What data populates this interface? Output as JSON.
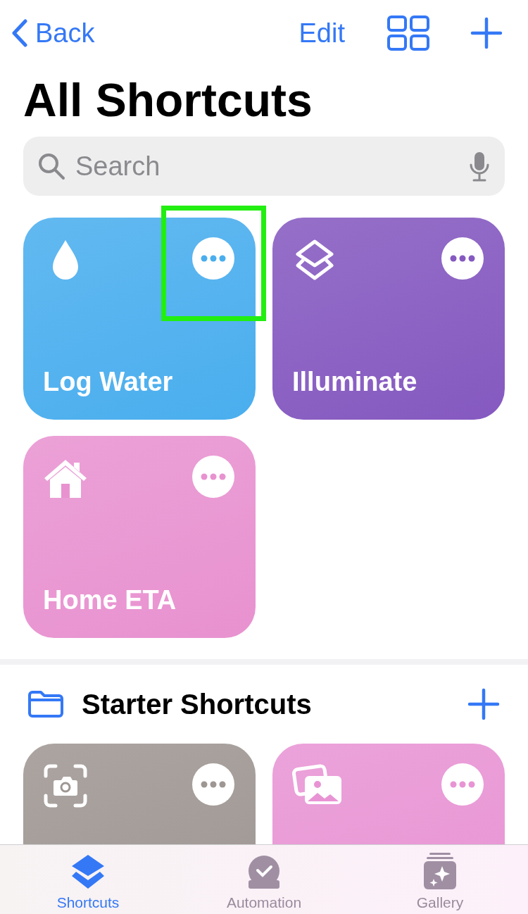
{
  "nav": {
    "back": "Back",
    "edit": "Edit"
  },
  "title": "All Shortcuts",
  "search": {
    "placeholder": "Search"
  },
  "shortcuts": [
    {
      "name": "Log Water",
      "kind": "drop",
      "color": "#4aaeee",
      "highlighted": true
    },
    {
      "name": "Illuminate",
      "kind": "layers",
      "color": "#8559c0",
      "highlighted": false
    },
    {
      "name": "Home ETA",
      "kind": "house",
      "color": "#e892d0",
      "highlighted": false
    }
  ],
  "folder": {
    "title": "Starter Shortcuts"
  },
  "starter_shortcuts": [
    {
      "kind": "camera",
      "color": "#9e9692"
    },
    {
      "kind": "photos",
      "color": "#e894d4"
    }
  ],
  "tabs": [
    {
      "label": "Shortcuts",
      "kind": "layers",
      "selected": true
    },
    {
      "label": "Automation",
      "kind": "clock",
      "selected": false
    },
    {
      "label": "Gallery",
      "kind": "gallery",
      "selected": false
    }
  ]
}
